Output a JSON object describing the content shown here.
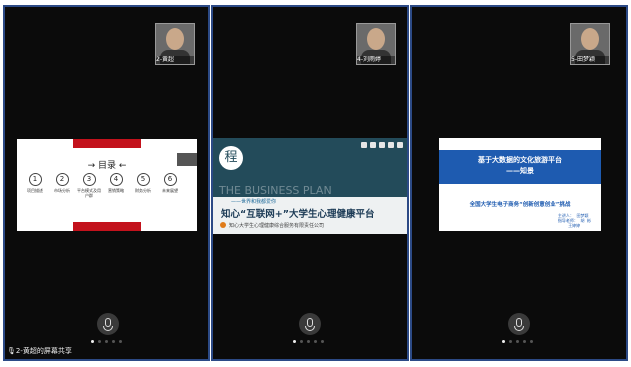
{
  "panes": [
    {
      "participant": "2-黄超",
      "bottom_label": "2-黄超的屏幕共享",
      "slide": {
        "title": "→ 目录 ←",
        "items": [
          {
            "num": "1",
            "label": "项目描述"
          },
          {
            "num": "2",
            "label": "市场分析"
          },
          {
            "num": "3",
            "label": "平台模式及用户群"
          },
          {
            "num": "4",
            "label": "营销策略"
          },
          {
            "num": "5",
            "label": "财务分析"
          },
          {
            "num": "6",
            "label": "未来展望"
          }
        ]
      }
    },
    {
      "participant": "4-刘雨婷",
      "slide": {
        "logo": "程",
        "bg_text": "THE BUSINESS PLAN",
        "subtitle": "——世界和我都爱你",
        "title": "知心“互联网+”大学生心理健康平台",
        "company": "知心大学生心理健康综合服务有限责任公司"
      }
    },
    {
      "participant": "5-田梦颖",
      "slide": {
        "title_line1": "基于大数据的文化旅游平台",
        "title_line2": "——知景",
        "contest": "全国大学生电子商务“创新创意创业”挑战",
        "team": "主讲人：  田梦颖\n指导老师：  胡  彬\n        王婷婷"
      }
    }
  ],
  "colors": {
    "pane_border": "#2c4a86",
    "red_band": "#c3121c",
    "teal": "#234b5a",
    "blue": "#1e5bb0"
  },
  "icons": [
    "microphone-icon",
    "pager-dots"
  ]
}
